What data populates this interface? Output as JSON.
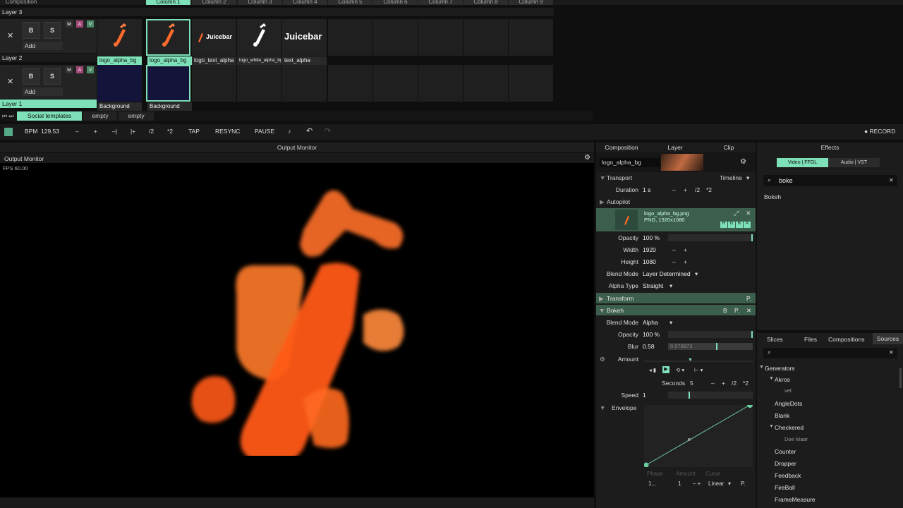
{
  "columns": [
    "Composition",
    "Column 1",
    "Column 2",
    "Column 3",
    "Column 4",
    "Column 5",
    "Column 6",
    "Column 7",
    "Column 8",
    "Column 9"
  ],
  "layers": {
    "layer3": "Layer 3",
    "layer2": "Layer 2",
    "layer1": "Layer 1",
    "b": "B",
    "s": "S",
    "x": "✕",
    "add": "Add",
    "m": "M",
    "a": "A",
    "v": "V",
    "row2_clips": [
      "logo_alpha_bg",
      "logo_alpha_bg",
      "logo_text_alpha",
      "logo_white_alpha_bg",
      "text_alpha"
    ],
    "row1_clips": [
      "Background",
      "Background"
    ],
    "juicebar_small": "Juicebar",
    "juicebar_big": "Juicebar"
  },
  "decks": [
    "Social templates",
    "empty",
    "empty"
  ],
  "transport": {
    "bpm_label": "BPM",
    "bpm": "129.53",
    "minus": "–",
    "plus": "+",
    "nudge_minus": "–|",
    "nudge_plus": "|+",
    "half": "/2",
    "double": "*2",
    "tap": "TAP",
    "resync": "RESYNC",
    "pause": "PAUSE",
    "record": "● RECORD"
  },
  "output": {
    "header": "Output Monitor",
    "title": "Output Monitor",
    "fps": "FPS 60.00"
  },
  "panel": {
    "tabs": [
      "Composition",
      "Layer",
      "Clip"
    ],
    "clip_name": "logo_alpha_bg",
    "transport": "Transport",
    "timeline": "Timeline",
    "duration_label": "Duration",
    "duration": "1 s",
    "half": "/2",
    "double": "*2",
    "autopilot": "Autopilot",
    "file_name": "logo_alpha_bg.png",
    "file_info": "PNG, 1920x1080",
    "rgba": [
      "R",
      "G",
      "B",
      "A"
    ],
    "opacity_label": "Opacity",
    "opacity": "100 %",
    "width_label": "Width",
    "width": "1920",
    "height_label": "Height",
    "height": "1080",
    "blend_label": "Blend Mode",
    "blend": "Layer Determined",
    "alpha_label": "Alpha Type",
    "alpha": "Straight",
    "transform": "Transform",
    "p": "P.",
    "bokeh": "Bokeh",
    "b": "B",
    "bokeh_blend": "Alpha",
    "bokeh_opacity": "100 %",
    "blur_label": "Blur",
    "blur": "0.58",
    "blur_exact": "0.578873",
    "amount_label": "Amount",
    "seconds_label": "Seconds",
    "seconds": "5",
    "speed_label": "Speed",
    "speed": "1",
    "envelope": "Envelope",
    "phase": "Phase",
    "amount_col": "Amount",
    "curve": "Curve",
    "phase_val": "1...",
    "amount_val": "1",
    "curve_val": "Linear"
  },
  "effects": {
    "title": "Effects",
    "tab_video": "Video | FFGL",
    "tab_audio": "Audio | VST",
    "search": "boke",
    "result": "Bokeh"
  },
  "sources": {
    "tabs": [
      "Slices",
      "Files",
      "Compositions",
      "Sources"
    ],
    "items": [
      "Generators",
      "Akros",
      "vet",
      "AngleDots",
      "Blank",
      "Checkered",
      "Doe Maar",
      "Counter",
      "Dropper",
      "Feedback",
      "FireBall",
      "FrameMeasure"
    ]
  },
  "colors": {
    "accent": "#7ee0b8",
    "group": "#3c5e4d",
    "orange": "#ff5a1a"
  }
}
